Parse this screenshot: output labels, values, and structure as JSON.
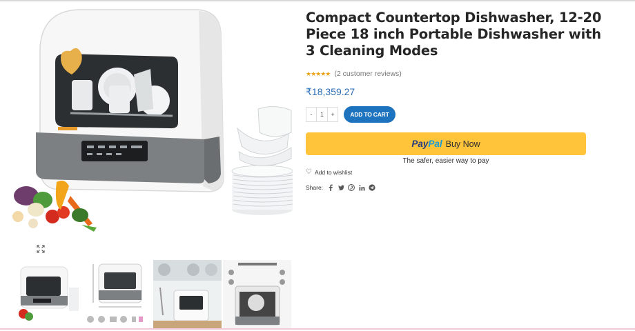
{
  "product": {
    "title": "Compact Countertop Dishwasher, 12-20 Piece 18 inch Portable Dishwasher with 3 Cleaning Modes",
    "rating_stars": "★★★★★",
    "reviews": "(2 customer reviews)",
    "price": "₹18,359.27"
  },
  "cart": {
    "minus": "-",
    "quantity": "1",
    "plus": "+",
    "add_to_cart": "ADD TO CART"
  },
  "paypal": {
    "logo_pay": "Pay",
    "logo_pal": "Pal",
    "button_text": "Buy Now",
    "tagline": "The safer, easier way to pay"
  },
  "wishlist": {
    "heart": "♡",
    "label": "Add to wishlist"
  },
  "share": {
    "label": "Share:",
    "icons": [
      "facebook-icon",
      "twitter-icon",
      "pinterest-icon",
      "linkedin-icon",
      "telegram-icon"
    ]
  },
  "colors": {
    "accent_blue": "#1e73be",
    "price_blue": "#2a6db5",
    "paypal_yellow": "#ffc43a",
    "star_gold": "#e8a317"
  }
}
